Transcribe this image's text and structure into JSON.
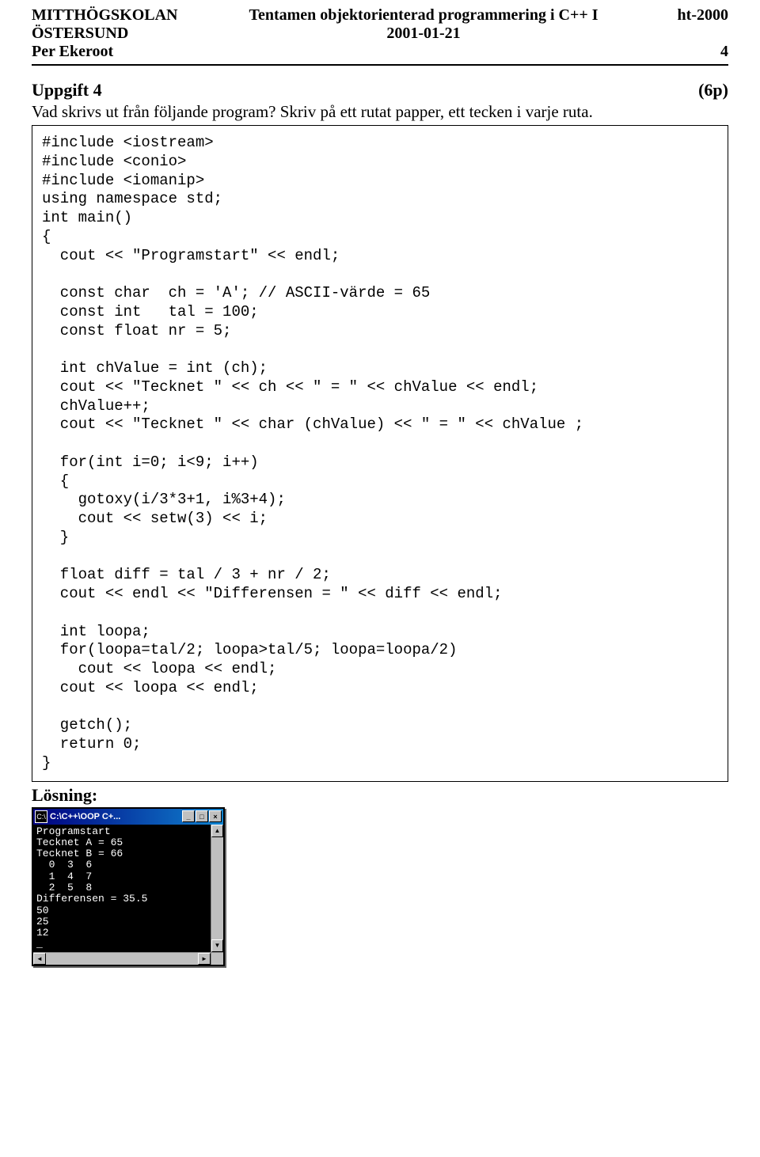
{
  "header": {
    "school_l1": "MITTHÖGSKOLAN",
    "school_l2": "ÖSTERSUND",
    "author": "Per Ekeroot",
    "title": "Tentamen objektorienterad programmering i C++ I",
    "date": "2001-01-21",
    "term": "ht-2000",
    "page": "4"
  },
  "task": {
    "label": "Uppgift 4",
    "points": "(6p)",
    "desc": "Vad skrivs ut från följande program? Skriv på ett rutat papper, ett  tecken i varje ruta."
  },
  "code": "#include <iostream>\n#include <conio>\n#include <iomanip>\nusing namespace std;\nint main()\n{\n  cout << \"Programstart\" << endl;\n\n  const char  ch = 'A'; // ASCII-värde = 65\n  const int   tal = 100;\n  const float nr = 5;\n\n  int chValue = int (ch);\n  cout << \"Tecknet \" << ch << \" = \" << chValue << endl;\n  chValue++;\n  cout << \"Tecknet \" << char (chValue) << \" = \" << chValue ;\n\n  for(int i=0; i<9; i++)\n  {\n    gotoxy(i/3*3+1, i%3+4);\n    cout << setw(3) << i;\n  }\n\n  float diff = tal / 3 + nr / 2;\n  cout << endl << \"Differensen = \" << diff << endl;\n\n  int loopa;\n  for(loopa=tal/2; loopa>tal/5; loopa=loopa/2)\n    cout << loopa << endl;\n  cout << loopa << endl;\n\n  getch();\n  return 0;\n}",
  "solution": {
    "label": "Lösning:",
    "window_title": "C:\\C++\\OOP C+...",
    "output": "Programstart\nTecknet A = 65\nTecknet B = 66\n  0  3  6\n  1  4  7\n  2  5  8\nDifferensen = 35.5\n50\n25\n12\n_",
    "icons": {
      "min": "_",
      "max": "□",
      "close": "×",
      "up": "▲",
      "down": "▼",
      "left": "◄",
      "right": "►",
      "app": "C:\\"
    }
  }
}
